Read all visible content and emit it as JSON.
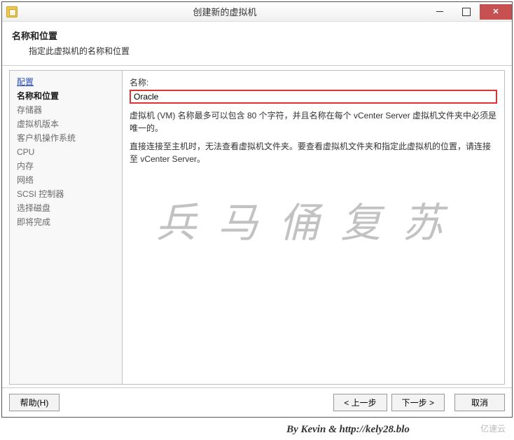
{
  "window": {
    "title": "创建新的虚拟机"
  },
  "header": {
    "title": "名称和位置",
    "subtitle": "指定此虚拟机的名称和位置"
  },
  "sidebar": {
    "items": [
      {
        "label": "配置",
        "state": "link"
      },
      {
        "label": "名称和位置",
        "state": "active"
      },
      {
        "label": "存储器",
        "state": "normal"
      },
      {
        "label": "虚拟机版本",
        "state": "normal"
      },
      {
        "label": "客户机操作系统",
        "state": "normal"
      },
      {
        "label": "CPU",
        "state": "normal"
      },
      {
        "label": "内存",
        "state": "normal"
      },
      {
        "label": "网络",
        "state": "normal"
      },
      {
        "label": "SCSI 控制器",
        "state": "normal"
      },
      {
        "label": "选择磁盘",
        "state": "normal"
      },
      {
        "label": "即将完成",
        "state": "normal"
      }
    ]
  },
  "content": {
    "name_label": "名称:",
    "name_value": "Oracle",
    "hint1": "虚拟机 (VM) 名称最多可以包含 80 个字符，并且名称在每个 vCenter Server 虚拟机文件夹中必须是唯一的。",
    "hint2": "直接连接至主机时，无法查看虚拟机文件夹。要查看虚拟机文件夹和指定此虚拟机的位置，请连接至 vCenter Server。"
  },
  "watermark": "兵马俑复苏",
  "footer": {
    "help": "帮助(H)",
    "back": "< 上一步",
    "next": "下一步 >",
    "cancel": "取消"
  },
  "caption": "By Kevin & http://kely28.blo",
  "corner": "亿速云"
}
